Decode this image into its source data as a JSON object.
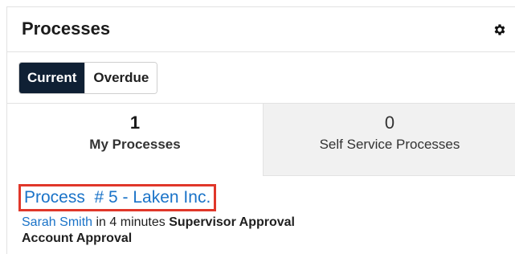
{
  "header": {
    "title": "Processes",
    "settings_icon": "gear-icon"
  },
  "filters": {
    "current_label": "Current",
    "overdue_label": "Overdue",
    "selected": "Current"
  },
  "tabs": [
    {
      "count": "1",
      "label": "My Processes",
      "selected": true
    },
    {
      "count": "0",
      "label": "Self Service Processes",
      "selected": false
    }
  ],
  "record": {
    "link_text": "Process  # 5 - Laken Inc.",
    "user": "Sarah Smith",
    "due": " in 4 minutes ",
    "activity": "Supervisor Approval",
    "process_name": "Account Approval",
    "highlight_color": "#e0372a"
  },
  "colors": {
    "accent": "#0f2034",
    "link": "#1a73c8"
  }
}
